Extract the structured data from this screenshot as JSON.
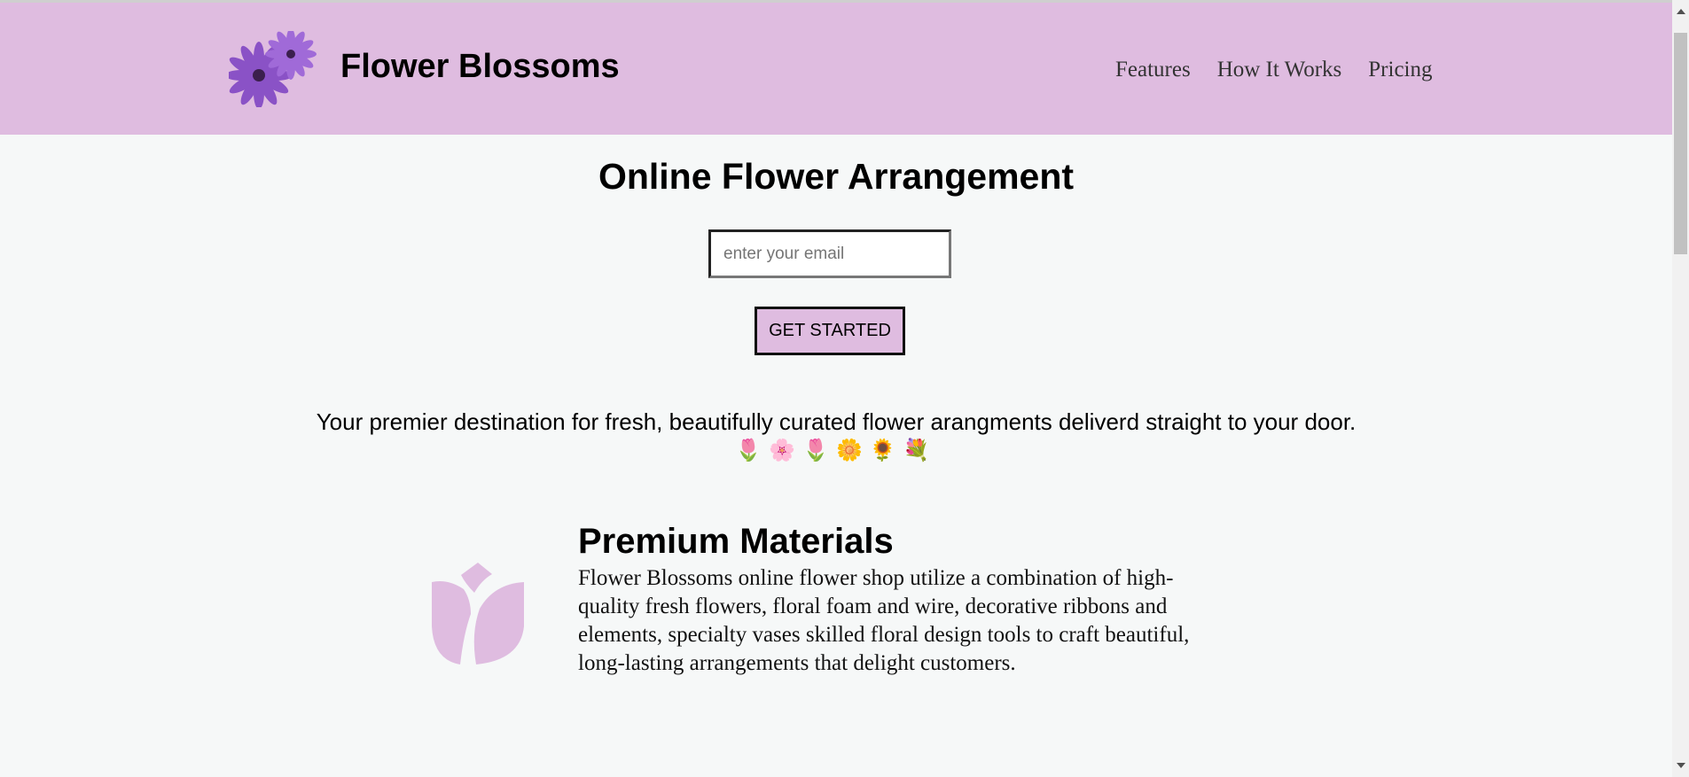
{
  "header": {
    "brand": "Flower Blossoms",
    "logo_icon": "purple-daisy-logo",
    "nav": [
      "Features",
      "How It Works",
      "Pricing"
    ]
  },
  "hero": {
    "title": "Online Flower Arrangement",
    "email_placeholder": "enter your email",
    "cta_label": "GET STARTED",
    "tagline": "Your premier destination for fresh, beautifully curated flower arangments deliverd straight to your door.",
    "emojis": "🌷🌸🌷🌼🌻💐"
  },
  "features": [
    {
      "icon": "tulip-icon",
      "title": "Premium Materials",
      "text": "Flower Blossoms online flower shop utilize a combination of high-quality fresh flowers, floral foam and wire, decorative ribbons and elements, specialty vases skilled floral design tools to craft beautiful, long-lasting arrangements that delight customers."
    }
  ],
  "colors": {
    "header_bg": "#dfbce0",
    "page_bg": "#f6f8f8",
    "icon_color": "#dfbce0"
  }
}
